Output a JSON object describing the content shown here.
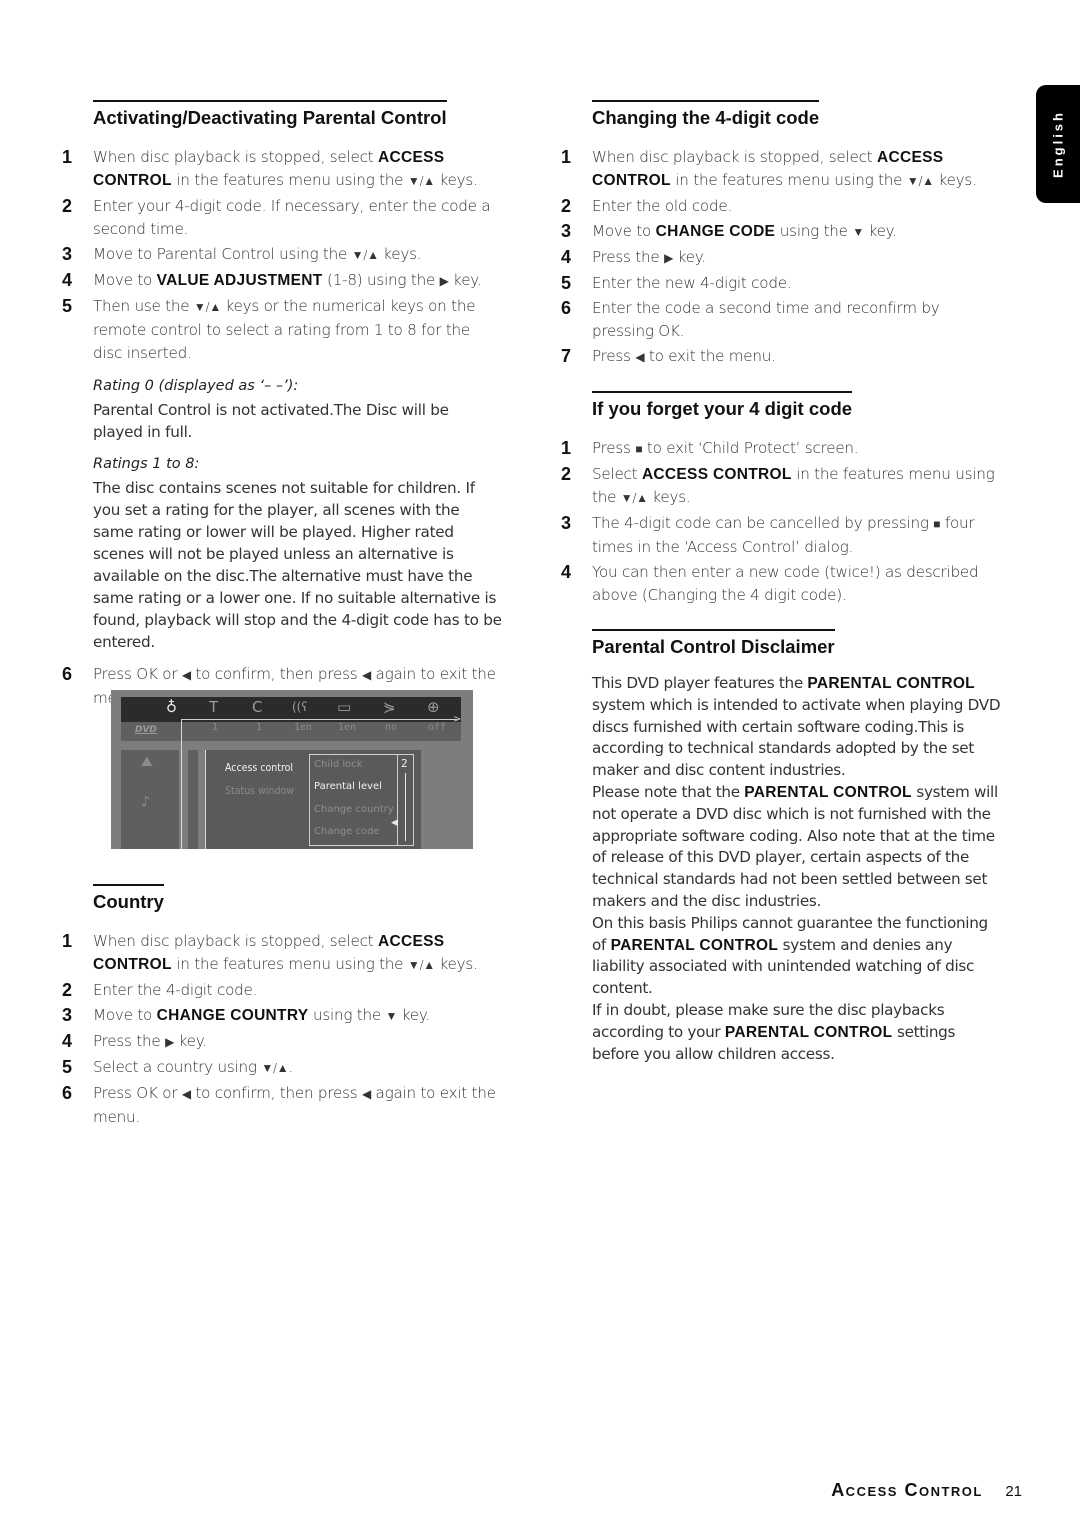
{
  "side_tab": {
    "language": "English"
  },
  "footer": {
    "section": "Access Control",
    "page_number": "21"
  },
  "glyphs": {
    "down_up": "▼/▲",
    "down": "▼",
    "up": "▲",
    "right": "▶",
    "left": "◀",
    "stop": "■"
  },
  "sections": {
    "activating": {
      "title": "Activating/Deactivating Parental Control",
      "steps": [
        {
          "num": "1",
          "parts": [
            "When disc playback is stopped, select ",
            "ACCESS CONTROL",
            " in the features menu using the ",
            "▼/▲",
            " keys."
          ]
        },
        {
          "num": "2",
          "text": "Enter your 4-digit code. If necessary, enter the code a second time."
        },
        {
          "num": "3",
          "parts": [
            "Move to Parental Control using the ",
            "▼/▲",
            " keys."
          ]
        },
        {
          "num": "4",
          "parts": [
            "Move to ",
            "VALUE ADJUSTMENT",
            " (1-8) using the ",
            "▶",
            " key."
          ]
        },
        {
          "num": "5",
          "parts": [
            "Then use the ",
            "▼/▲",
            " keys or the numerical keys on the remote control to select a rating from 1 to 8 for the disc inserted."
          ]
        }
      ],
      "rating0": {
        "label": "Rating 0 (displayed as ‘– –’):",
        "text": "Parental Control is not activated.The Disc will be played in full."
      },
      "ratings1to8": {
        "label": "Ratings 1 to 8:",
        "text": "The disc contains scenes not suitable for children. If you set a rating for the player, all scenes with the same rating or lower will be played. Higher rated scenes will not be played unless an alternative is available on the disc.The alternative must have the same rating or a lower one. If no suitable alternative is found, playback will stop and the 4-digit code has to be entered."
      },
      "step6": {
        "num": "6",
        "parts": [
          "Press OK or ",
          "◀",
          " to confirm, then press ",
          "◀",
          " again to exit the menu."
        ]
      }
    },
    "osd": {
      "top_values": [
        "1",
        "1",
        "1en",
        "1en",
        "no",
        "off"
      ],
      "disc_logo": "DVD",
      "menu_items": [
        {
          "label": "Access control",
          "active": true
        },
        {
          "label": "Status window",
          "active": false
        }
      ],
      "submenu_items": [
        {
          "label": "Child lock",
          "active": false
        },
        {
          "label": "Parental level",
          "active": true
        },
        {
          "label": "Change country",
          "active": false
        },
        {
          "label": "Change code",
          "active": false
        }
      ],
      "level_value": "2"
    },
    "country": {
      "title": "Country",
      "steps": [
        {
          "num": "1",
          "parts": [
            "When disc playback is stopped, select ",
            "ACCESS CONTROL",
            " in the features menu using the ",
            "▼/▲",
            " keys."
          ]
        },
        {
          "num": "2",
          "text": "Enter the 4-digit code."
        },
        {
          "num": "3",
          "parts": [
            "Move to ",
            "CHANGE COUNTRY",
            " using the ",
            "▼",
            " key."
          ]
        },
        {
          "num": "4",
          "parts": [
            "Press the ",
            "▶",
            " key."
          ]
        },
        {
          "num": "5",
          "parts": [
            "Select a country using ",
            "▼/▲",
            "."
          ]
        },
        {
          "num": "6",
          "parts": [
            "Press OK or ",
            "◀",
            " to confirm, then press ",
            "◀",
            " again to exit the menu."
          ]
        }
      ]
    },
    "change_code": {
      "title": "Changing the 4-digit code",
      "steps": [
        {
          "num": "1",
          "parts": [
            "When disc playback is stopped, select ",
            "ACCESS CONTROL",
            " in the features menu using the ",
            "▼/▲",
            " keys."
          ]
        },
        {
          "num": "2",
          "text": "Enter the old code."
        },
        {
          "num": "3",
          "parts": [
            "Move to ",
            "CHANGE CODE",
            " using the ",
            "▼",
            " key."
          ]
        },
        {
          "num": "4",
          "parts": [
            "Press the ",
            "▶",
            " key."
          ]
        },
        {
          "num": "5",
          "text": "Enter the new 4-digit code."
        },
        {
          "num": "6",
          "text": "Enter the code a second time and reconfirm by pressing OK."
        },
        {
          "num": "7",
          "parts": [
            "Press ",
            "◀",
            " to exit the menu."
          ]
        }
      ]
    },
    "forget_code": {
      "title": "If you forget your 4 digit code",
      "steps": [
        {
          "num": "1",
          "parts": [
            "Press ",
            "■",
            " to exit ‘Child Protect’ screen."
          ]
        },
        {
          "num": "2",
          "parts": [
            "Select ",
            "ACCESS CONTROL",
            " in the features menu using the ",
            "▼/▲",
            " keys."
          ]
        },
        {
          "num": "3",
          "parts": [
            "The 4-digit code can be cancelled by pressing ",
            "■",
            " four times in the ‘Access Control’ dialog."
          ]
        },
        {
          "num": "4",
          "text": "You can then enter a new code (twice!) as described above (Changing the 4 digit code)."
        }
      ]
    },
    "disclaimer": {
      "title": "Parental Control Disclaimer",
      "paragraphs": [
        [
          "This DVD player features the ",
          "PARENTAL CONTROL",
          " system which is intended to activate when playing DVD discs furnished with certain software coding.This is according to technical standards adopted by the set maker and disc content industries."
        ],
        [
          "Please note that the ",
          "PARENTAL CONTROL",
          " system will not operate a DVD disc which is not furnished with the appropriate software coding. Also note that at the time of release of this DVD player, certain aspects of the technical standards had not been settled between set makers and the disc industries."
        ],
        [
          "On this basis Philips cannot guarantee the functioning of ",
          "PARENTAL CONTROL",
          " system and denies any liability associated with unintended watching of disc content."
        ],
        [
          "If in doubt, please make sure the disc playbacks according to your ",
          "PARENTAL CONTROL",
          " settings before you allow children access."
        ]
      ]
    }
  }
}
